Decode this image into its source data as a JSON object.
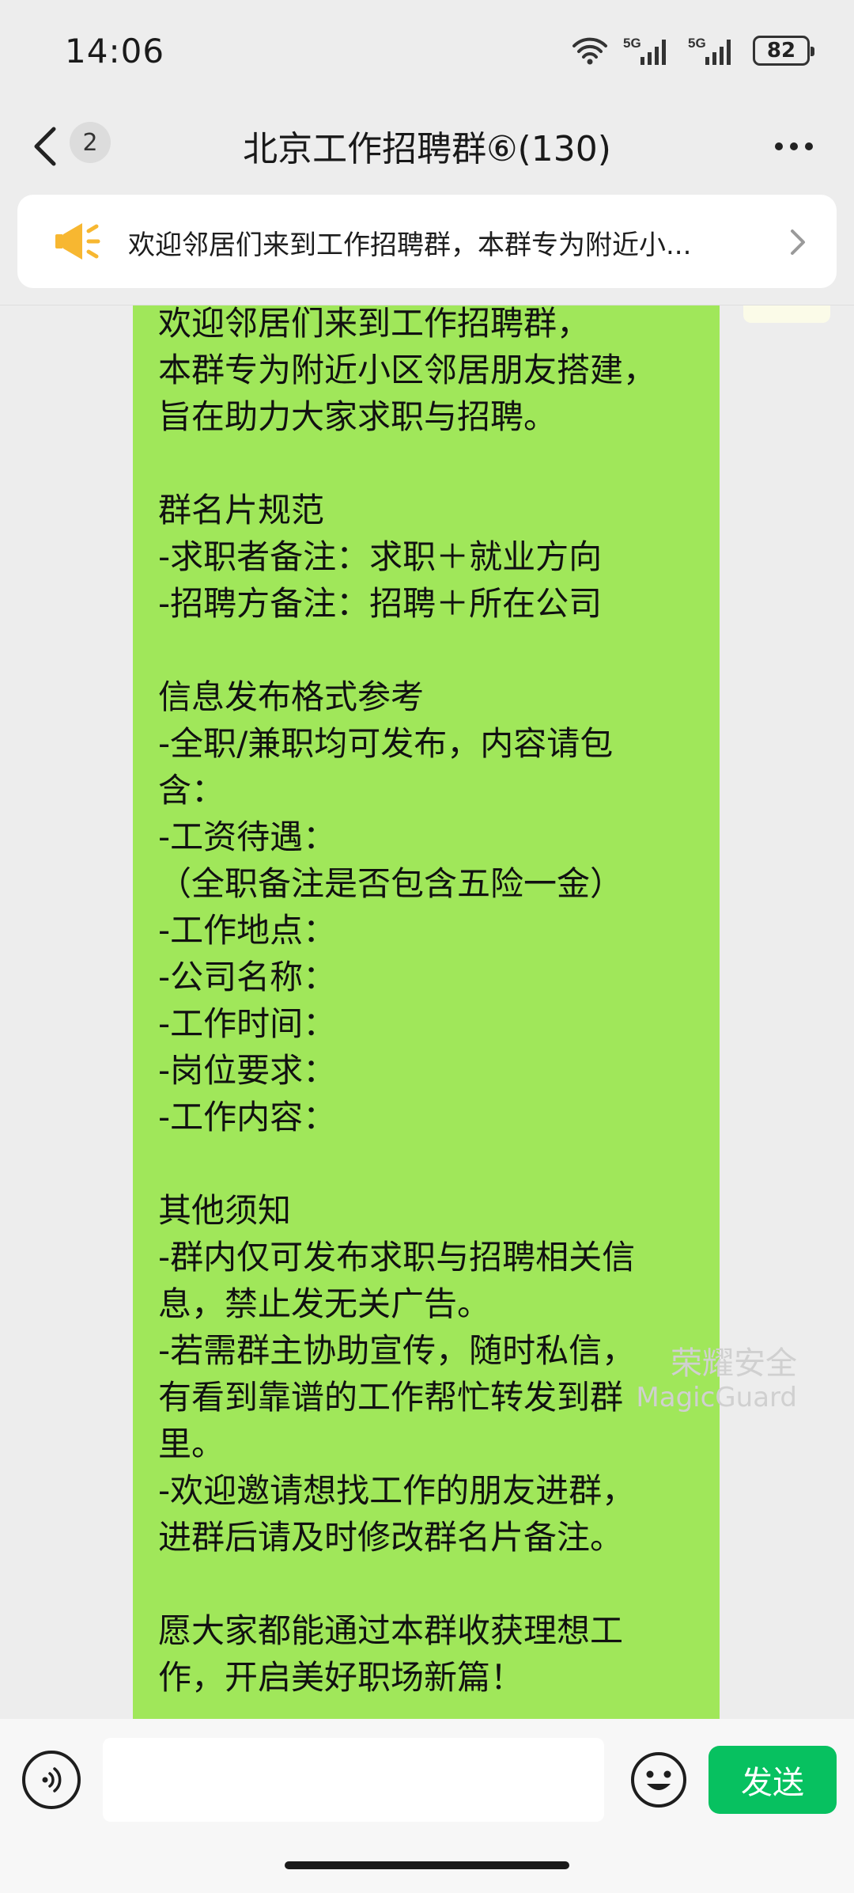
{
  "status_bar": {
    "time": "14:06",
    "network_1": "5G",
    "network_2": "5G",
    "battery": "82"
  },
  "nav": {
    "unread_count": "2",
    "title": "北京工作招聘群⑥(130)"
  },
  "announcement": {
    "text": "欢迎邻居们来到工作招聘群，本群专为附近小...",
    "icon": "megaphone-icon",
    "icon_color": "#f7b731"
  },
  "message": {
    "text": "欢迎邻居们来到工作招聘群，\n本群专为附近小区邻居朋友搭建，\n旨在助力大家求职与招聘。\n\n群名片规范\n-求职者备注：求职＋就业方向\n-招聘方备注：招聘＋所在公司\n\n信息发布格式参考\n-全职/兼职均可发布，内容请包\n含：\n-工资待遇：\n（全职备注是否包含五险一金）\n-工作地点：\n-公司名称：\n-工作时间：\n-岗位要求：\n-工作内容：\n\n其他须知\n-群内仅可发布求职与招聘相关信\n息，禁止发无关广告。\n-若需群主协助宣传，随时私信，\n有看到靠谱的工作帮忙转发到群\n里。\n-欢迎邀请想找工作的朋友进群，\n进群后请及时修改群名片备注。\n\n愿大家都能通过本群收获理想工\n作，开启美好职场新篇！",
    "bubble_color": "#a0e75a"
  },
  "watermark": {
    "line1": "荣耀安全",
    "line2": "MagicGuard"
  },
  "input_bar": {
    "placeholder": "",
    "send_label": "发送",
    "send_color": "#07c160"
  }
}
